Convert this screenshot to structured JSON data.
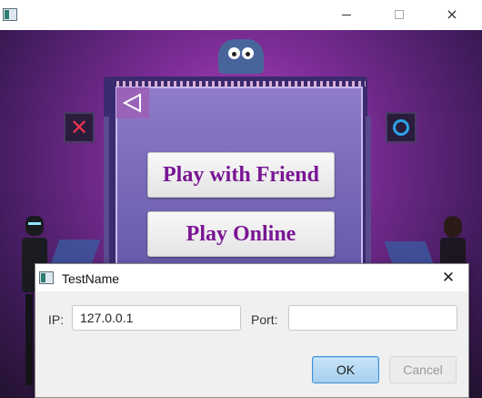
{
  "window": {
    "title": "",
    "controls": {
      "minimize": "minimize-icon",
      "maximize": "maximize-icon",
      "close": "×"
    }
  },
  "game": {
    "back_icon": "triangle-back-icon",
    "play_friend_label": "Play with Friend",
    "play_online_label": "Play Online",
    "x_symbol": "✕",
    "colors": {
      "button_text": "#7a1594",
      "x_color": "#e8344f",
      "o_color": "#2ba5e9",
      "back_bg": "#9a63b8"
    }
  },
  "dialog": {
    "title": "TestName",
    "close_label": "✕",
    "ip_label": "IP:",
    "ip_value": "127.0.0.1",
    "port_label": "Port:",
    "port_value": "",
    "ok_label": "OK",
    "cancel_label": "Cancel"
  }
}
